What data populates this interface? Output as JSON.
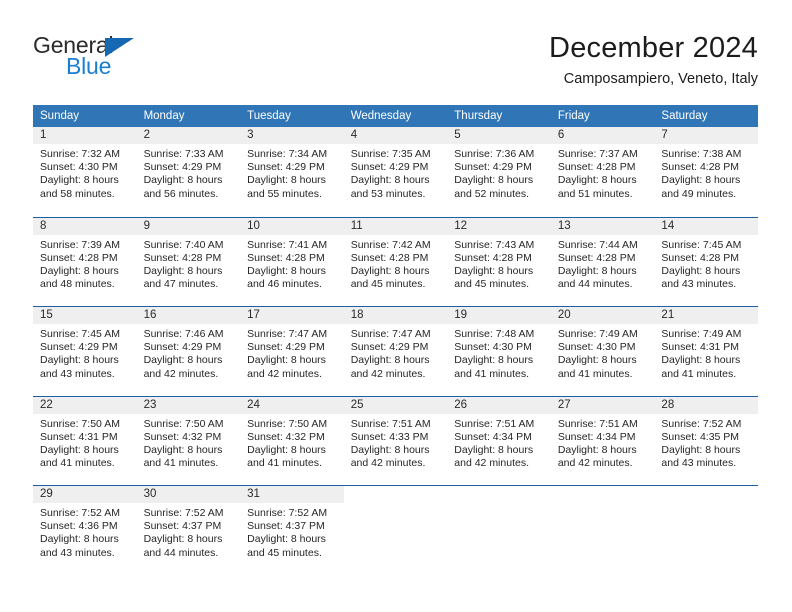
{
  "brand": {
    "word_one": "General",
    "word_two": "Blue",
    "triangle_color": "#1668b3",
    "blue_text_color": "#1a7ed1"
  },
  "header": {
    "title": "December 2024",
    "subtitle": "Camposampiero, Veneto, Italy"
  },
  "theme": {
    "header_bg": "#3075b5",
    "row_divider": "#1d5fa0",
    "daynum_bg": "#efefef",
    "text": "#262626"
  },
  "weekdays": [
    "Sunday",
    "Monday",
    "Tuesday",
    "Wednesday",
    "Thursday",
    "Friday",
    "Saturday"
  ],
  "weeks": [
    [
      {
        "day": "1",
        "sunrise": "Sunrise: 7:32 AM",
        "sunset": "Sunset: 4:30 PM",
        "daylight1": "Daylight: 8 hours",
        "daylight2": "and 58 minutes."
      },
      {
        "day": "2",
        "sunrise": "Sunrise: 7:33 AM",
        "sunset": "Sunset: 4:29 PM",
        "daylight1": "Daylight: 8 hours",
        "daylight2": "and 56 minutes."
      },
      {
        "day": "3",
        "sunrise": "Sunrise: 7:34 AM",
        "sunset": "Sunset: 4:29 PM",
        "daylight1": "Daylight: 8 hours",
        "daylight2": "and 55 minutes."
      },
      {
        "day": "4",
        "sunrise": "Sunrise: 7:35 AM",
        "sunset": "Sunset: 4:29 PM",
        "daylight1": "Daylight: 8 hours",
        "daylight2": "and 53 minutes."
      },
      {
        "day": "5",
        "sunrise": "Sunrise: 7:36 AM",
        "sunset": "Sunset: 4:29 PM",
        "daylight1": "Daylight: 8 hours",
        "daylight2": "and 52 minutes."
      },
      {
        "day": "6",
        "sunrise": "Sunrise: 7:37 AM",
        "sunset": "Sunset: 4:28 PM",
        "daylight1": "Daylight: 8 hours",
        "daylight2": "and 51 minutes."
      },
      {
        "day": "7",
        "sunrise": "Sunrise: 7:38 AM",
        "sunset": "Sunset: 4:28 PM",
        "daylight1": "Daylight: 8 hours",
        "daylight2": "and 49 minutes."
      }
    ],
    [
      {
        "day": "8",
        "sunrise": "Sunrise: 7:39 AM",
        "sunset": "Sunset: 4:28 PM",
        "daylight1": "Daylight: 8 hours",
        "daylight2": "and 48 minutes."
      },
      {
        "day": "9",
        "sunrise": "Sunrise: 7:40 AM",
        "sunset": "Sunset: 4:28 PM",
        "daylight1": "Daylight: 8 hours",
        "daylight2": "and 47 minutes."
      },
      {
        "day": "10",
        "sunrise": "Sunrise: 7:41 AM",
        "sunset": "Sunset: 4:28 PM",
        "daylight1": "Daylight: 8 hours",
        "daylight2": "and 46 minutes."
      },
      {
        "day": "11",
        "sunrise": "Sunrise: 7:42 AM",
        "sunset": "Sunset: 4:28 PM",
        "daylight1": "Daylight: 8 hours",
        "daylight2": "and 45 minutes."
      },
      {
        "day": "12",
        "sunrise": "Sunrise: 7:43 AM",
        "sunset": "Sunset: 4:28 PM",
        "daylight1": "Daylight: 8 hours",
        "daylight2": "and 45 minutes."
      },
      {
        "day": "13",
        "sunrise": "Sunrise: 7:44 AM",
        "sunset": "Sunset: 4:28 PM",
        "daylight1": "Daylight: 8 hours",
        "daylight2": "and 44 minutes."
      },
      {
        "day": "14",
        "sunrise": "Sunrise: 7:45 AM",
        "sunset": "Sunset: 4:28 PM",
        "daylight1": "Daylight: 8 hours",
        "daylight2": "and 43 minutes."
      }
    ],
    [
      {
        "day": "15",
        "sunrise": "Sunrise: 7:45 AM",
        "sunset": "Sunset: 4:29 PM",
        "daylight1": "Daylight: 8 hours",
        "daylight2": "and 43 minutes."
      },
      {
        "day": "16",
        "sunrise": "Sunrise: 7:46 AM",
        "sunset": "Sunset: 4:29 PM",
        "daylight1": "Daylight: 8 hours",
        "daylight2": "and 42 minutes."
      },
      {
        "day": "17",
        "sunrise": "Sunrise: 7:47 AM",
        "sunset": "Sunset: 4:29 PM",
        "daylight1": "Daylight: 8 hours",
        "daylight2": "and 42 minutes."
      },
      {
        "day": "18",
        "sunrise": "Sunrise: 7:47 AM",
        "sunset": "Sunset: 4:29 PM",
        "daylight1": "Daylight: 8 hours",
        "daylight2": "and 42 minutes."
      },
      {
        "day": "19",
        "sunrise": "Sunrise: 7:48 AM",
        "sunset": "Sunset: 4:30 PM",
        "daylight1": "Daylight: 8 hours",
        "daylight2": "and 41 minutes."
      },
      {
        "day": "20",
        "sunrise": "Sunrise: 7:49 AM",
        "sunset": "Sunset: 4:30 PM",
        "daylight1": "Daylight: 8 hours",
        "daylight2": "and 41 minutes."
      },
      {
        "day": "21",
        "sunrise": "Sunrise: 7:49 AM",
        "sunset": "Sunset: 4:31 PM",
        "daylight1": "Daylight: 8 hours",
        "daylight2": "and 41 minutes."
      }
    ],
    [
      {
        "day": "22",
        "sunrise": "Sunrise: 7:50 AM",
        "sunset": "Sunset: 4:31 PM",
        "daylight1": "Daylight: 8 hours",
        "daylight2": "and 41 minutes."
      },
      {
        "day": "23",
        "sunrise": "Sunrise: 7:50 AM",
        "sunset": "Sunset: 4:32 PM",
        "daylight1": "Daylight: 8 hours",
        "daylight2": "and 41 minutes."
      },
      {
        "day": "24",
        "sunrise": "Sunrise: 7:50 AM",
        "sunset": "Sunset: 4:32 PM",
        "daylight1": "Daylight: 8 hours",
        "daylight2": "and 41 minutes."
      },
      {
        "day": "25",
        "sunrise": "Sunrise: 7:51 AM",
        "sunset": "Sunset: 4:33 PM",
        "daylight1": "Daylight: 8 hours",
        "daylight2": "and 42 minutes."
      },
      {
        "day": "26",
        "sunrise": "Sunrise: 7:51 AM",
        "sunset": "Sunset: 4:34 PM",
        "daylight1": "Daylight: 8 hours",
        "daylight2": "and 42 minutes."
      },
      {
        "day": "27",
        "sunrise": "Sunrise: 7:51 AM",
        "sunset": "Sunset: 4:34 PM",
        "daylight1": "Daylight: 8 hours",
        "daylight2": "and 42 minutes."
      },
      {
        "day": "28",
        "sunrise": "Sunrise: 7:52 AM",
        "sunset": "Sunset: 4:35 PM",
        "daylight1": "Daylight: 8 hours",
        "daylight2": "and 43 minutes."
      }
    ],
    [
      {
        "day": "29",
        "sunrise": "Sunrise: 7:52 AM",
        "sunset": "Sunset: 4:36 PM",
        "daylight1": "Daylight: 8 hours",
        "daylight2": "and 43 minutes."
      },
      {
        "day": "30",
        "sunrise": "Sunrise: 7:52 AM",
        "sunset": "Sunset: 4:37 PM",
        "daylight1": "Daylight: 8 hours",
        "daylight2": "and 44 minutes."
      },
      {
        "day": "31",
        "sunrise": "Sunrise: 7:52 AM",
        "sunset": "Sunset: 4:37 PM",
        "daylight1": "Daylight: 8 hours",
        "daylight2": "and 45 minutes."
      },
      {
        "day": "",
        "sunrise": "",
        "sunset": "",
        "daylight1": "",
        "daylight2": ""
      },
      {
        "day": "",
        "sunrise": "",
        "sunset": "",
        "daylight1": "",
        "daylight2": ""
      },
      {
        "day": "",
        "sunrise": "",
        "sunset": "",
        "daylight1": "",
        "daylight2": ""
      },
      {
        "day": "",
        "sunrise": "",
        "sunset": "",
        "daylight1": "",
        "daylight2": ""
      }
    ]
  ]
}
